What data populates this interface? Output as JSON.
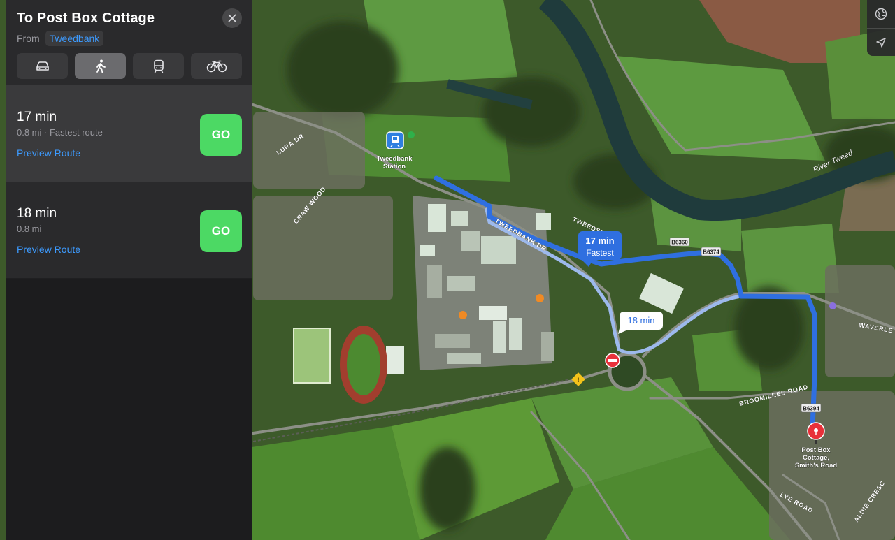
{
  "panel": {
    "title": "To Post Box Cottage",
    "from_label": "From",
    "from_value": "Tweedbank",
    "modes": [
      {
        "icon": "car-icon",
        "selected": false
      },
      {
        "icon": "walk-icon",
        "selected": true
      },
      {
        "icon": "train-icon",
        "selected": false
      },
      {
        "icon": "bicycle-icon",
        "selected": false
      }
    ],
    "routes": [
      {
        "time": "17 min",
        "detail": "0.8 mi · Fastest route",
        "preview": "Preview Route",
        "go": "GO"
      },
      {
        "time": "18 min",
        "detail": "0.8 mi",
        "preview": "Preview Route",
        "go": "GO"
      }
    ]
  },
  "map": {
    "callout_primary_time": "17 min",
    "callout_primary_label": "Fastest",
    "callout_alt_time": "18 min",
    "station_label_line1": "Tweedbank",
    "station_label_line2": "Station",
    "destination_line1": "Post Box",
    "destination_line2": "Cottage,",
    "destination_line3": "Smith's Road",
    "roads": {
      "tweedbank_dr": "TWEEDBANK DR",
      "tweedside": "TWEEDSI",
      "craw_wood": "CRAW WOOD",
      "lura_dr": "LURA DR",
      "broomilees": "BROOMILEES ROAD",
      "lye_road": "LYE ROAD",
      "waverley": "WAVERLE",
      "aldie": "ALDIE CRESC",
      "river": "River Tweed"
    },
    "shields": [
      "B6360",
      "B6374",
      "B6394"
    ],
    "colors": {
      "route_primary": "#2f6fe0",
      "route_alt": "#8fb0ea",
      "go": "#4cd964",
      "link": "#3d9bff",
      "pin": "#e8313a"
    }
  }
}
